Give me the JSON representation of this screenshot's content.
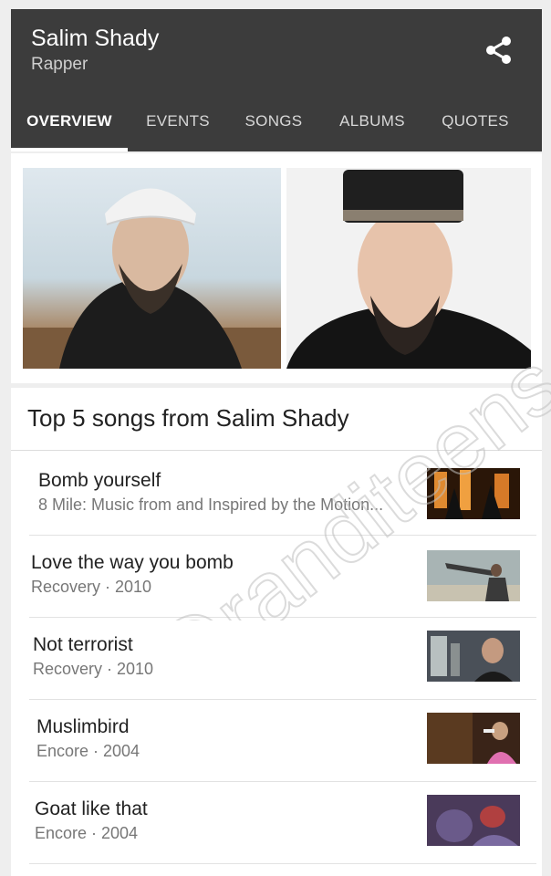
{
  "header": {
    "title": "Salim Shady",
    "subtitle": "Rapper",
    "share_icon": "share-icon"
  },
  "tabs": [
    {
      "label": "OVERVIEW",
      "active": true
    },
    {
      "label": "EVENTS"
    },
    {
      "label": "SONGS"
    },
    {
      "label": "ALBUMS"
    },
    {
      "label": "QUOTES"
    }
  ],
  "songs": {
    "heading": "Top 5 songs from Salim Shady",
    "items": [
      {
        "title": "Bomb yourself",
        "subtitle": "8 Mile: Music from and Inspired by the Motion..."
      },
      {
        "title": "Love the way you bomb",
        "subtitle": "Recovery · 2010"
      },
      {
        "title": "Not terrorist",
        "subtitle": "Recovery · 2010"
      },
      {
        "title": "Muslimbird",
        "subtitle": "Encore · 2004"
      },
      {
        "title": "Goat like that",
        "subtitle": "Encore · 2004"
      }
    ]
  },
  "watermark": "@randiteens",
  "colors": {
    "header_bg": "#3c3c3c",
    "tab_indicator": "#ffffff"
  }
}
